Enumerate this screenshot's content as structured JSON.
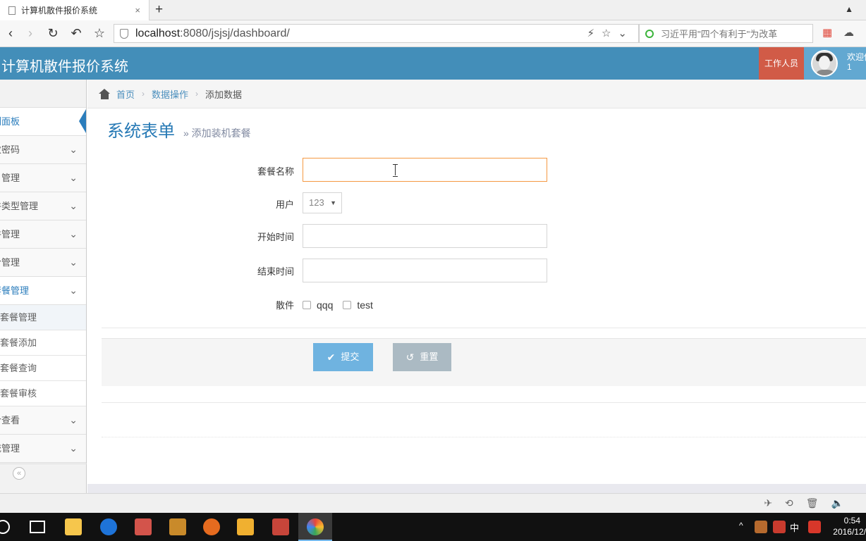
{
  "browser": {
    "tab_title": "计算机散件报价系统",
    "tab_close": "×",
    "new_tab": "+",
    "url_host": "localhost",
    "url_rest": ":8080/jsjsj/dashboard/",
    "search_text": "习近平用\"四个有利于\"为改革"
  },
  "app": {
    "title": "计算机散件报价系统",
    "role_label": "工作人员",
    "welcome_line1": "欢迎你",
    "welcome_line2": "1"
  },
  "sidebar": {
    "items": [
      {
        "label": "控制面板",
        "state": "active"
      },
      {
        "label": "修改密码",
        "state": "collapsed"
      },
      {
        "label": "用户管理",
        "state": "collapsed"
      },
      {
        "label": "散件类型管理",
        "state": "collapsed"
      },
      {
        "label": "散件管理",
        "state": "collapsed"
      },
      {
        "label": "报价管理",
        "state": "collapsed"
      },
      {
        "label": "装机套餐管理",
        "state": "open"
      }
    ],
    "subitems": [
      "装机套餐管理",
      "装机套餐添加",
      "装机套餐查询",
      "装机套餐审核"
    ],
    "items_after": [
      "报价查看",
      "系统管理"
    ],
    "collapse_glyph": "«"
  },
  "breadcrumb": {
    "home": "首页",
    "section": "数据操作",
    "current": "添加数据",
    "separator": "›"
  },
  "page": {
    "title": "系统表单",
    "subtitle": "» 添加装机套餐"
  },
  "form": {
    "name_label": "套餐名称",
    "name_value": "",
    "user_label": "用户",
    "user_selected": "123",
    "start_label": "开始时间",
    "start_value": "",
    "end_label": "结束时间",
    "end_value": "",
    "parts_label": "散件",
    "parts_options": [
      "qqq",
      "test"
    ],
    "submit_label": "提交",
    "reset_label": "重置"
  },
  "taskbar": {
    "clock_time": "0:54",
    "clock_date": "2016/12/",
    "ime": "中"
  },
  "colors": {
    "header_blue": "#438eb9",
    "role_red": "#d15b47",
    "submit_blue": "#6fb3e0",
    "reset_gray": "#abbac3",
    "input_focus": "#f59942"
  }
}
